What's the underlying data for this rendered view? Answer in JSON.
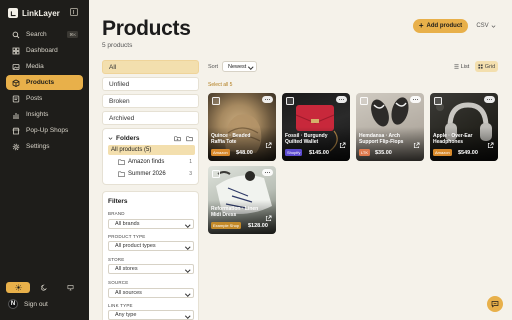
{
  "app": {
    "name": "LinkLayer"
  },
  "sidebar": {
    "search": {
      "label": "Search",
      "shortcut": "⌘K"
    },
    "items": [
      {
        "label": "Dashboard",
        "icon": "grid-icon"
      },
      {
        "label": "Media",
        "icon": "image-icon"
      },
      {
        "label": "Products",
        "icon": "box-icon",
        "active": true
      },
      {
        "label": "Posts",
        "icon": "post-icon"
      },
      {
        "label": "Insights",
        "icon": "chart-icon"
      },
      {
        "label": "Pop-Up Shops",
        "icon": "store-icon"
      },
      {
        "label": "Settings",
        "icon": "gear-icon"
      }
    ],
    "signout": "Sign out",
    "avatar_letter": "N"
  },
  "header": {
    "title": "Products",
    "count": "5 products",
    "add_button": "Add product",
    "csv_button": "CSV"
  },
  "status_filters": [
    {
      "label": "All",
      "active": true
    },
    {
      "label": "Unfiled"
    },
    {
      "label": "Broken"
    },
    {
      "label": "Archived"
    }
  ],
  "folders": {
    "title": "Folders",
    "rows": [
      {
        "label": "All products (5)",
        "active": true
      },
      {
        "label": "Amazon finds",
        "count": "1"
      },
      {
        "label": "Summer 2026",
        "count": "3"
      }
    ]
  },
  "filters": {
    "title": "Filters",
    "groups": [
      {
        "label": "BRAND",
        "value": "All brands"
      },
      {
        "label": "PRODUCT TYPE",
        "value": "All product types"
      },
      {
        "label": "STORE",
        "value": "All stores"
      },
      {
        "label": "SOURCE",
        "value": "All sources"
      },
      {
        "label": "LINK TYPE",
        "value": "Any type"
      }
    ]
  },
  "toolbar": {
    "sort_label": "Sort",
    "sort_value": "Newest",
    "view_list": "List",
    "view_grid": "Grid",
    "select_all": "Select all 5"
  },
  "products": [
    {
      "name": "Quince · Beaded Raffia Tote",
      "store": "Amazon",
      "store_color": "#d98a2b",
      "price": "$48.00"
    },
    {
      "name": "Fossil · Burgundy Quilted Wallet",
      "store": "Shopify",
      "store_color": "#5c4bd1",
      "price": "$145.00"
    },
    {
      "name": "Hemdansa · Arch Support Flip-Flops",
      "store": "LTK",
      "store_color": "#e07a4e",
      "price": "$35.00"
    },
    {
      "name": "Apple · Over-Ear Headphones",
      "store": "Amazon",
      "store_color": "#d98a2b",
      "price": "$549.00"
    },
    {
      "name": "Reformation · Linen Midi Dress",
      "store": "Example Shop",
      "store_color": "#c48a2a",
      "price": "$128.00"
    }
  ],
  "colors": {
    "accent": "#e8b04a",
    "sidebar_bg": "#1e1d1a",
    "page_bg": "#f5f2ea"
  }
}
